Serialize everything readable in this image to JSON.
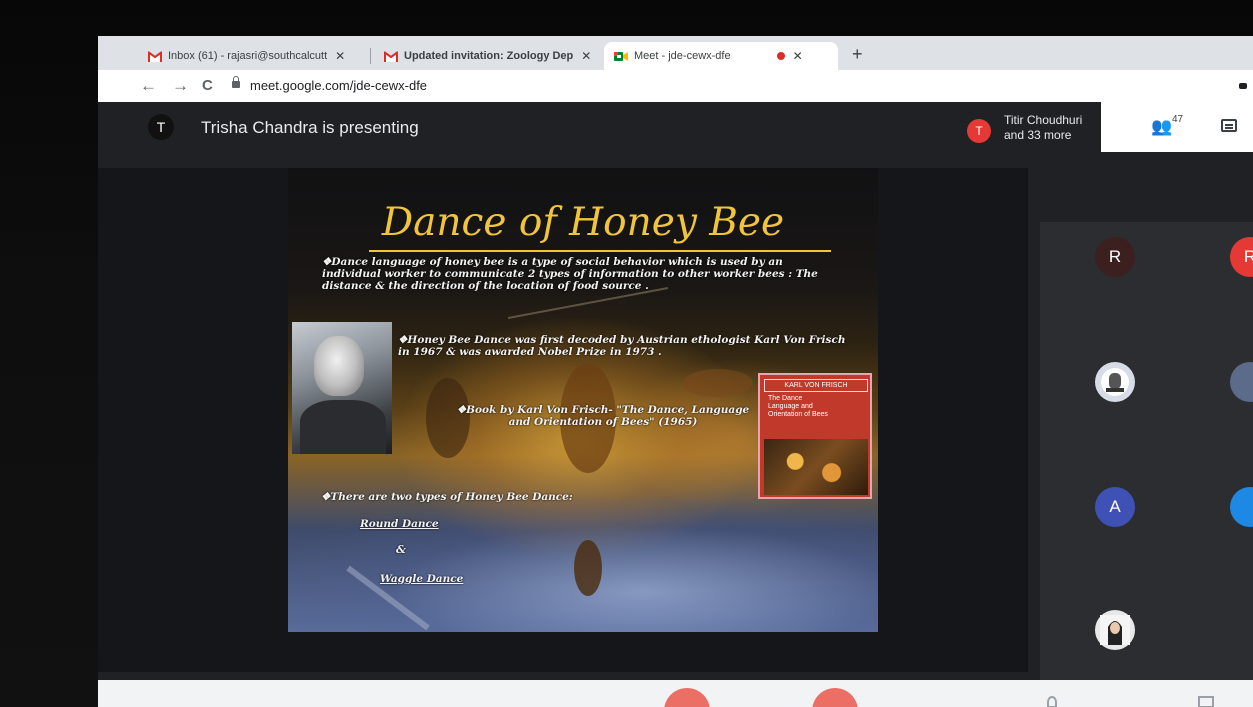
{
  "browser": {
    "tabs": [
      {
        "label": "Inbox (61) - rajasri@southcalcutt",
        "close": "✕"
      },
      {
        "label": "Updated invitation: Zoology Dep",
        "close": "✕"
      },
      {
        "label": "Meet - jde-cewx-dfe",
        "close": "✕"
      }
    ],
    "new_tab": "+",
    "url": "meet.google.com/jde-cewx-dfe",
    "nav": {
      "back": "←",
      "forward": "→",
      "reload": "C"
    }
  },
  "meet": {
    "presenter_initial": "T",
    "presenting_text": "Trisha Chandra is presenting",
    "host_initial": "T",
    "host_name": "Titir Choudhuri",
    "host_more": "and 33 more",
    "people_count": "47",
    "participants": [
      {
        "initial": "R",
        "color": "#3c1f1f"
      },
      {
        "initial": "R",
        "color": "#e53935"
      },
      {
        "initial": "A",
        "color": "#3f51b5"
      }
    ]
  },
  "slide": {
    "title": "Dance of Honey Bee",
    "para1": "❖Dance language of honey bee is a type of social behavior which is used by an individual worker to communicate 2 types of information to other worker bees : The distance & the direction of the location of food source .",
    "para2": "❖Honey Bee Dance was first decoded by Austrian ethologist Karl Von Frisch in 1967 & was awarded Nobel Prize in 1973 .",
    "para3": "❖Book by Karl Von Frisch- \"The Dance, Language and Orientation of Bees\" (1965)",
    "para4": "❖There are two types of Honey Bee Dance:",
    "dance1": "Round Dance",
    "and": "&",
    "dance2": "Waggle Dance",
    "book": {
      "author": "KARL VON FRISCH",
      "title_l1": "The Dance",
      "title_l2": "Language and",
      "title_l3": "Orientation of Bees"
    }
  },
  "colors": {
    "title_gold": "#f2c43b",
    "meet_bg": "#202124",
    "danger": "#ea4335"
  }
}
